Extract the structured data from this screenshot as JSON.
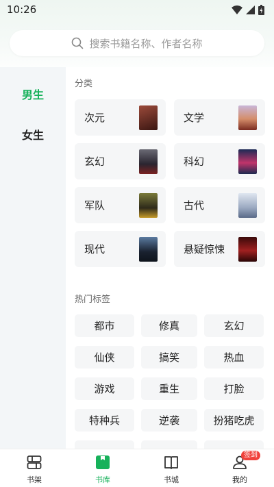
{
  "status": {
    "time": "10:26"
  },
  "search": {
    "placeholder": "搜索书籍名称、作者名称"
  },
  "sidebar": {
    "items": [
      {
        "label": "男生"
      },
      {
        "label": "女生"
      }
    ]
  },
  "sections": {
    "category_title": "分类",
    "tags_title": "热门标签"
  },
  "categories": [
    {
      "label": "次元",
      "cover_color": "#6b2a24"
    },
    {
      "label": "文学",
      "cover_color": "#c9827a"
    },
    {
      "label": "玄幻",
      "cover_color": "#3a3540"
    },
    {
      "label": "科幻",
      "cover_color": "#2a3560"
    },
    {
      "label": "军队",
      "cover_color": "#5a5a2e"
    },
    {
      "label": "古代",
      "cover_color": "#b7c2d4"
    },
    {
      "label": "现代",
      "cover_color": "#28364a"
    },
    {
      "label": "悬疑惊悚",
      "cover_color": "#7a1a1a"
    }
  ],
  "tags": [
    "都市",
    "修真",
    "玄幻",
    "仙侠",
    "搞笑",
    "热血",
    "游戏",
    "重生",
    "打脸",
    "特种兵",
    "逆袭",
    "扮猪吃虎"
  ],
  "bottom_nav": {
    "items": [
      {
        "label": "书架"
      },
      {
        "label": "书库"
      },
      {
        "label": "书城"
      },
      {
        "label": "我的"
      }
    ],
    "badge": "签到",
    "active_color": "#16b15a"
  }
}
